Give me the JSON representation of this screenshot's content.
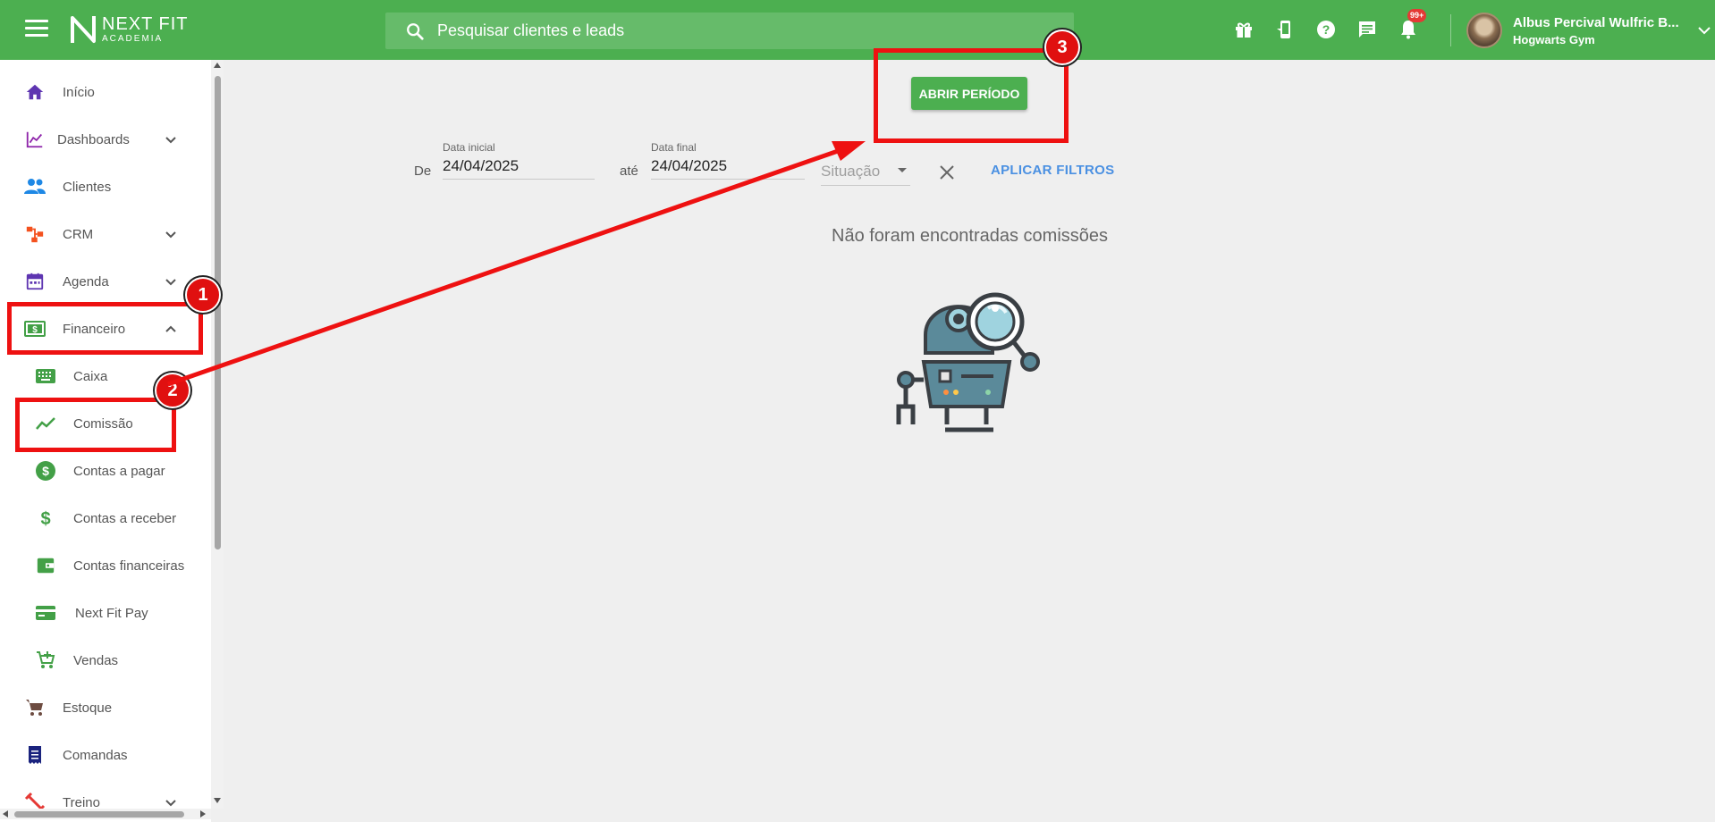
{
  "topbar": {
    "logo_line1": "NEXT FIT",
    "logo_line2": "ACADEMIA",
    "search_placeholder": "Pesquisar clientes e leads",
    "notifications_badge": "99+",
    "user_name": "Albus Percival Wulfric B...",
    "user_gym": "Hogwarts Gym"
  },
  "sidebar": {
    "items": [
      {
        "label": "Início",
        "icon": "home-icon",
        "color": "#5e35b1"
      },
      {
        "label": "Dashboards",
        "icon": "chart-line-icon",
        "color": "#8e24aa"
      },
      {
        "label": "Clientes",
        "icon": "people-icon",
        "color": "#1e88e5"
      },
      {
        "label": "CRM",
        "icon": "crm-icon",
        "color": "#f4511e"
      },
      {
        "label": "Agenda",
        "icon": "calendar-icon",
        "color": "#5e35b1"
      },
      {
        "label": "Financeiro",
        "icon": "money-icon",
        "color": "#43a047"
      },
      {
        "label": "Caixa",
        "icon": "keyboard-icon",
        "color": "#43a047"
      },
      {
        "label": "Comissão",
        "icon": "trend-icon",
        "color": "#43a047"
      },
      {
        "label": "Contas a pagar",
        "icon": "dollar-circle-icon",
        "color": "#43a047"
      },
      {
        "label": "Contas a receber",
        "icon": "dollar-icon",
        "color": "#43a047"
      },
      {
        "label": "Contas financeiras",
        "icon": "wallet-icon",
        "color": "#43a047"
      },
      {
        "label": "Next Fit Pay",
        "icon": "card-icon",
        "color": "#43a047"
      },
      {
        "label": "Vendas",
        "icon": "cart-add-icon",
        "color": "#43a047"
      },
      {
        "label": "Estoque",
        "icon": "cart-icon",
        "color": "#6d4c41"
      },
      {
        "label": "Comandas",
        "icon": "receipt-icon",
        "color": "#1a237e"
      },
      {
        "label": "Treino",
        "icon": "dumbbell-icon",
        "color": "#e53935"
      }
    ]
  },
  "main": {
    "open_period_button": "ABRIR PERÍODO",
    "from_label": "De",
    "start_date_label": "Data inicial",
    "start_date_value": "24/04/2025",
    "until_label": "até",
    "end_date_label": "Data final",
    "end_date_value": "24/04/2025",
    "status_placeholder": "Situação",
    "apply_filters": "APLICAR FILTROS",
    "empty_message": "Não foram encontradas comissões"
  },
  "annotations": {
    "step1": "1",
    "step2": "2",
    "step3": "3",
    "color": "#ee1111"
  }
}
